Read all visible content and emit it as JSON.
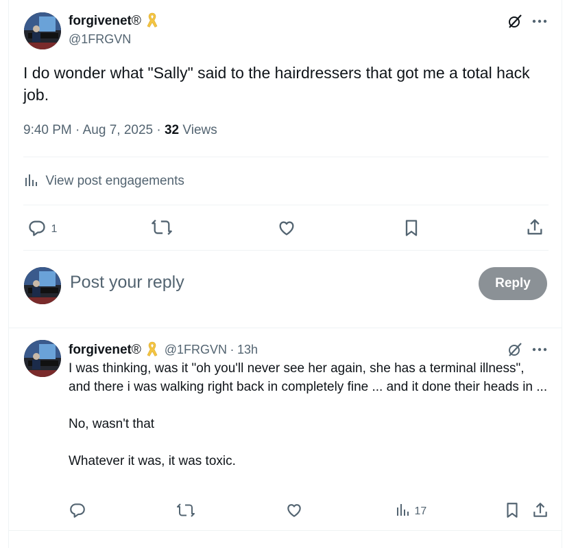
{
  "main_post": {
    "display_name": "forgivenet",
    "registered_mark": "®",
    "handle": "@1FRGVN",
    "text": "I do wonder what \"Sally\" said to the hairdressers that got me a total hack job.",
    "time": "9:40 PM",
    "date": "Aug 7, 2025",
    "views_count": "32",
    "views_label": "Views",
    "engagements_label": "View post engagements",
    "reply_count": "1"
  },
  "composer": {
    "placeholder": "Post your reply",
    "reply_button": "Reply"
  },
  "reply_post": {
    "display_name": "forgivenet",
    "registered_mark": "®",
    "handle": "@1FRGVN",
    "age": "13h",
    "para1": "I was thinking, was it \"oh you'll never see her again, she has a terminal illness\", and there i was walking right back in completely fine ... and it done their heads in ...",
    "para2": "No, wasn't that",
    "para3": "Whatever it was, it was toxic.",
    "views_count": "17"
  },
  "colors": {
    "text": "#0f1419",
    "muted": "#536471",
    "ribbon": "#f4c542",
    "reply_button_disabled": "#8b9196"
  },
  "icons": [
    "grok-icon",
    "more-icon",
    "analytics-icon",
    "reply-icon",
    "repost-icon",
    "like-icon",
    "bookmark-icon",
    "share-icon",
    "ribbon-icon"
  ]
}
